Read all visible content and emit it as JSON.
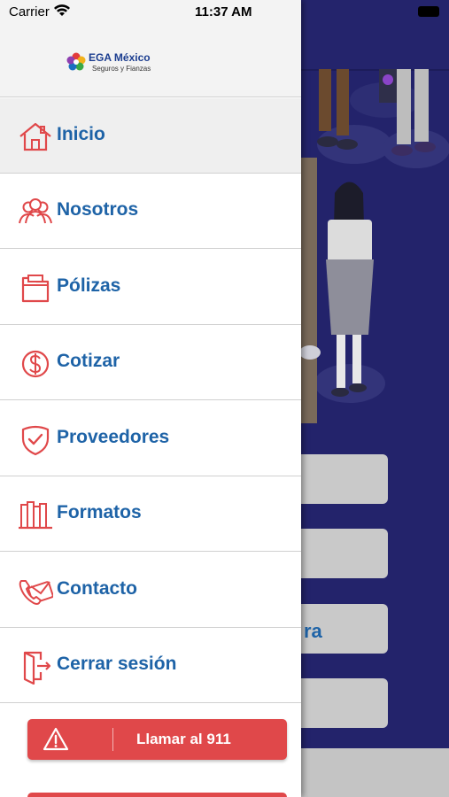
{
  "status_bar": {
    "carrier": "Carrier",
    "time": "11:37 AM"
  },
  "logo": {
    "brand": "EGA México",
    "tagline": "Seguros y Fianzas"
  },
  "menu": {
    "items": [
      {
        "label": "Inicio",
        "icon": "home-icon",
        "active": true
      },
      {
        "label": "Nosotros",
        "icon": "people-icon"
      },
      {
        "label": "Pólizas",
        "icon": "folder-icon"
      },
      {
        "label": "Cotizar",
        "icon": "dollar-icon"
      },
      {
        "label": "Proveedores",
        "icon": "shield-check-icon"
      },
      {
        "label": "Formatos",
        "icon": "books-icon"
      },
      {
        "label": "Contacto",
        "icon": "phone-mail-icon"
      },
      {
        "label": "Cerrar sesión",
        "icon": "logout-icon"
      }
    ]
  },
  "emergency": {
    "label": "Llamar al 911",
    "icon": "warning-icon"
  },
  "background": {
    "partial_text": "ra"
  },
  "colors": {
    "accent_red": "#e0484a",
    "label_blue": "#1e63a7",
    "background_navy": "#23236b"
  }
}
